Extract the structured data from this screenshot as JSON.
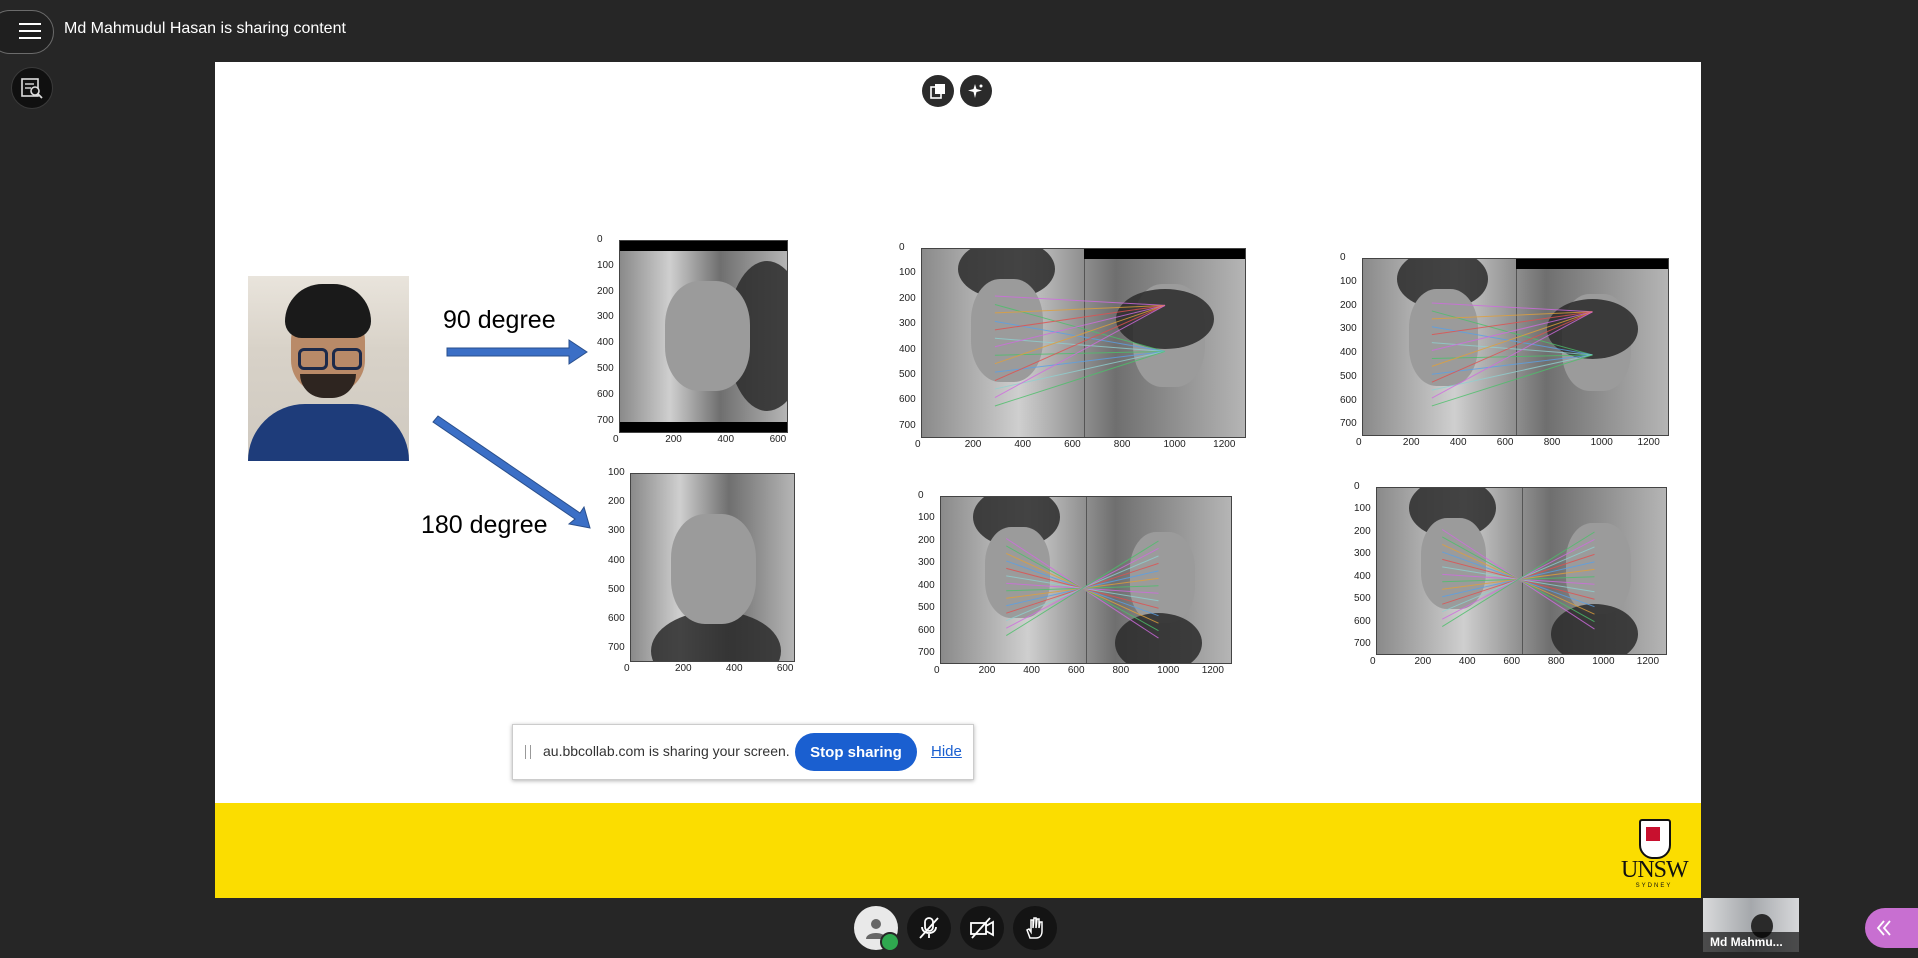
{
  "header": {
    "sharing_text": "Md Mahmudul Hasan is sharing content"
  },
  "slide": {
    "arrow_labels": [
      "90 degree",
      "180 degree"
    ],
    "plots": [
      {
        "xticks": [
          "0",
          "200",
          "400",
          "600"
        ],
        "yticks": [
          "0",
          "100",
          "200",
          "300",
          "400",
          "500",
          "600",
          "700"
        ]
      },
      {
        "xticks": [
          "0",
          "200",
          "400",
          "600",
          "800",
          "1000",
          "1200"
        ],
        "yticks": [
          "0",
          "100",
          "200",
          "300",
          "400",
          "500",
          "600",
          "700"
        ]
      },
      {
        "xticks": [
          "0",
          "200",
          "400",
          "600",
          "800",
          "1000",
          "1200"
        ],
        "yticks": [
          "0",
          "100",
          "200",
          "300",
          "400",
          "500",
          "600",
          "700"
        ]
      },
      {
        "xticks": [
          "0",
          "200",
          "400",
          "600"
        ],
        "yticks": [
          "100",
          "200",
          "300",
          "400",
          "500",
          "600",
          "700"
        ]
      },
      {
        "xticks": [
          "0",
          "200",
          "400",
          "600",
          "800",
          "1000",
          "1200"
        ],
        "yticks": [
          "0",
          "100",
          "200",
          "300",
          "400",
          "500",
          "600",
          "700"
        ]
      },
      {
        "xticks": [
          "0",
          "200",
          "400",
          "600",
          "800",
          "1000",
          "1200"
        ],
        "yticks": [
          "0",
          "100",
          "200",
          "300",
          "400",
          "500",
          "600",
          "700"
        ]
      }
    ],
    "logo": {
      "text": "UNSW",
      "sub": "SYDNEY"
    }
  },
  "share_bar": {
    "message": "au.bbcollab.com is sharing your screen.",
    "stop_label": "Stop sharing",
    "hide_label": "Hide"
  },
  "self_view": {
    "name": "Md Mahmu..."
  },
  "colors": {
    "banner": "#fbdd00",
    "stop_button": "#1a5fd0",
    "collapse": "#c86fd1",
    "arrow": "#3b6fc6"
  },
  "icons": [
    "menu-icon",
    "captions-icon",
    "copy-icon",
    "sparkle-icon",
    "avatar-icon",
    "mic-muted-icon",
    "camera-off-icon",
    "hand-raise-icon",
    "chevron-left-icon"
  ]
}
